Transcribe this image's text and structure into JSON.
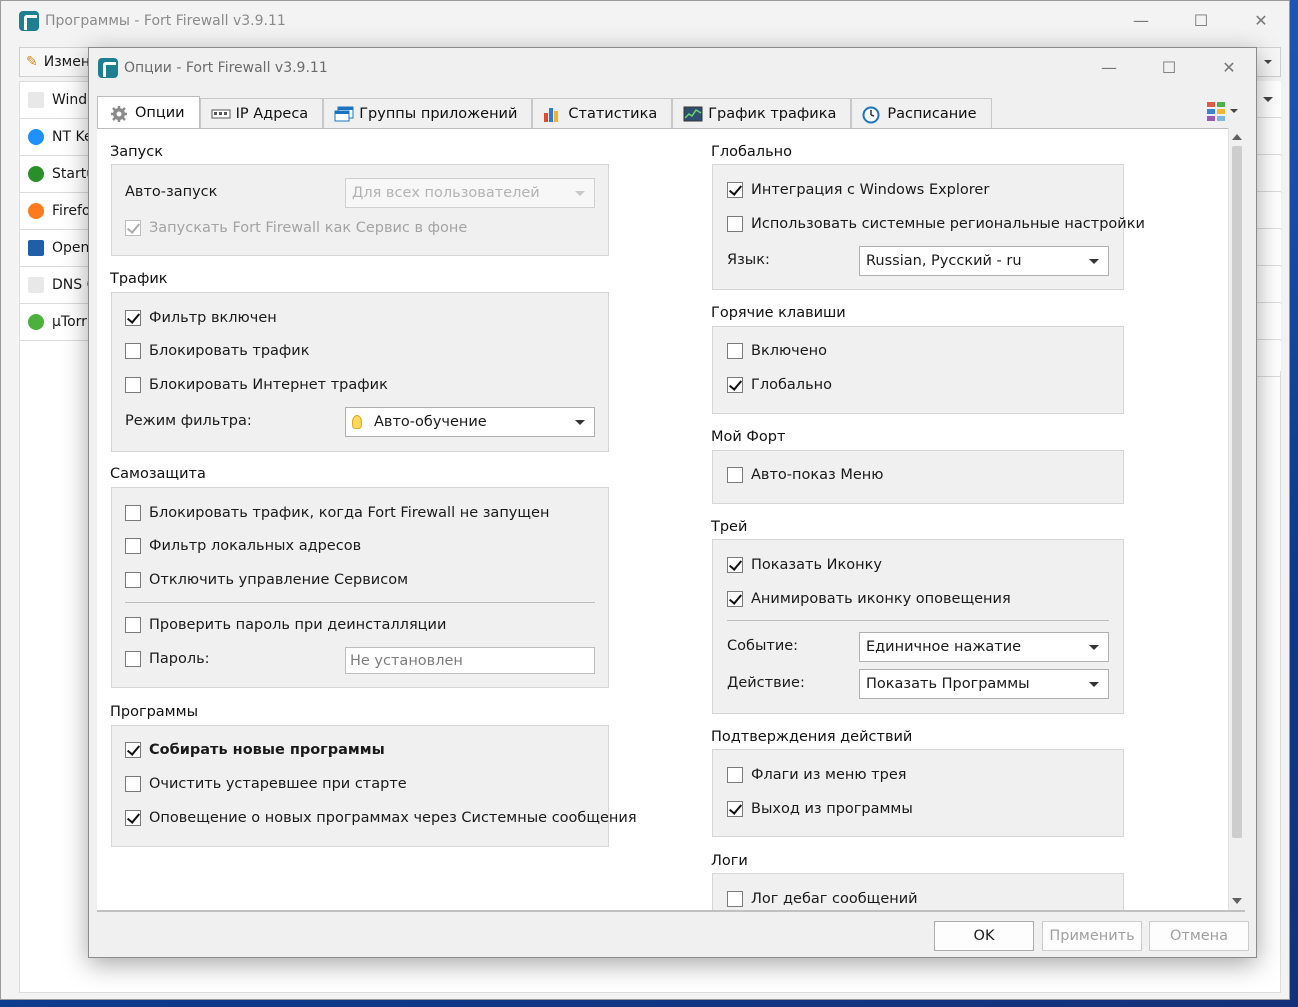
{
  "back_window": {
    "title": "Программы - Fort Firewall v3.9.11",
    "edit_label": "Измен",
    "rows": [
      {
        "label": "Windo",
        "icon": "exe-file-icon"
      },
      {
        "label": "NT Ke",
        "icon": "windows-logo-icon"
      },
      {
        "label": "Startu",
        "icon": "power-icon"
      },
      {
        "label": "Firefo",
        "icon": "firefox-icon"
      },
      {
        "label": "Open",
        "icon": "openvpn-icon"
      },
      {
        "label": "DNS C",
        "icon": "exe-file-icon"
      },
      {
        "label": "µTorr",
        "icon": "utorrent-icon"
      }
    ]
  },
  "dialog": {
    "title": "Опции - Fort Firewall v3.9.11",
    "tabs": [
      {
        "label": "Опции",
        "icon": "gear-icon",
        "active": true
      },
      {
        "label": "IP Адреса",
        "icon": "network-card-icon"
      },
      {
        "label": "Группы приложений",
        "icon": "window-group-icon"
      },
      {
        "label": "Статистика",
        "icon": "bar-chart-icon"
      },
      {
        "label": "График трафика",
        "icon": "traffic-graph-icon"
      },
      {
        "label": "Расписание",
        "icon": "clock-icon"
      }
    ],
    "buttons": {
      "ok": "OK",
      "apply": "Применить",
      "cancel": "Отмена"
    }
  },
  "left": {
    "startup": {
      "title": "Запуск",
      "autostart_label": "Авто-запуск",
      "autostart_value": "Для всех пользователей",
      "service_label": "Запускать Fort Firewall как Сервис в фоне"
    },
    "traffic": {
      "title": "Трафик",
      "filter_enabled": "Фильтр включен",
      "block_traffic": "Блокировать трафик",
      "block_inet": "Блокировать Интернет трафик",
      "mode_label": "Режим фильтра:",
      "mode_value": "Авто-обучение"
    },
    "selfprot": {
      "title": "Самозащита",
      "block_not_running": "Блокировать трафик, когда Fort Firewall не запущен",
      "filter_local": "Фильтр локальных адресов",
      "disable_service": "Отключить управление Сервисом",
      "check_pwd": "Проверить пароль при деинсталляции",
      "password_label": "Пароль:",
      "password_placeholder": "Не установлен"
    },
    "programs": {
      "title": "Программы",
      "collect_new": "Собирать новые программы",
      "purge_on_start": "Очистить устаревшее при старте",
      "notify_new": "Оповещение о новых программах через Системные сообщения"
    }
  },
  "right": {
    "global": {
      "title": "Глобально",
      "explorer": "Интеграция с Windows Explorer",
      "regional": "Использовать системные региональные настройки",
      "language_label": "Язык:",
      "language_value": "Russian, Русский - ru"
    },
    "hotkeys": {
      "title": "Горячие клавиши",
      "enabled": "Включено",
      "global": "Глобально"
    },
    "myfort": {
      "title": "Мой Форт",
      "autoshow": "Авто-показ Меню"
    },
    "tray": {
      "title": "Трей",
      "show_icon": "Показать Иконку",
      "animate": "Анимировать иконку оповещения",
      "event_label": "Событие:",
      "event_value": "Единичное нажатие",
      "action_label": "Действие:",
      "action_value": "Показать Программы"
    },
    "confirm": {
      "title": "Подтверждения действий",
      "tray_flags": "Флаги из меню трея",
      "exit": "Выход из программы"
    },
    "logs": {
      "title": "Логи",
      "debug": "Лог дебаг сообщений"
    }
  }
}
